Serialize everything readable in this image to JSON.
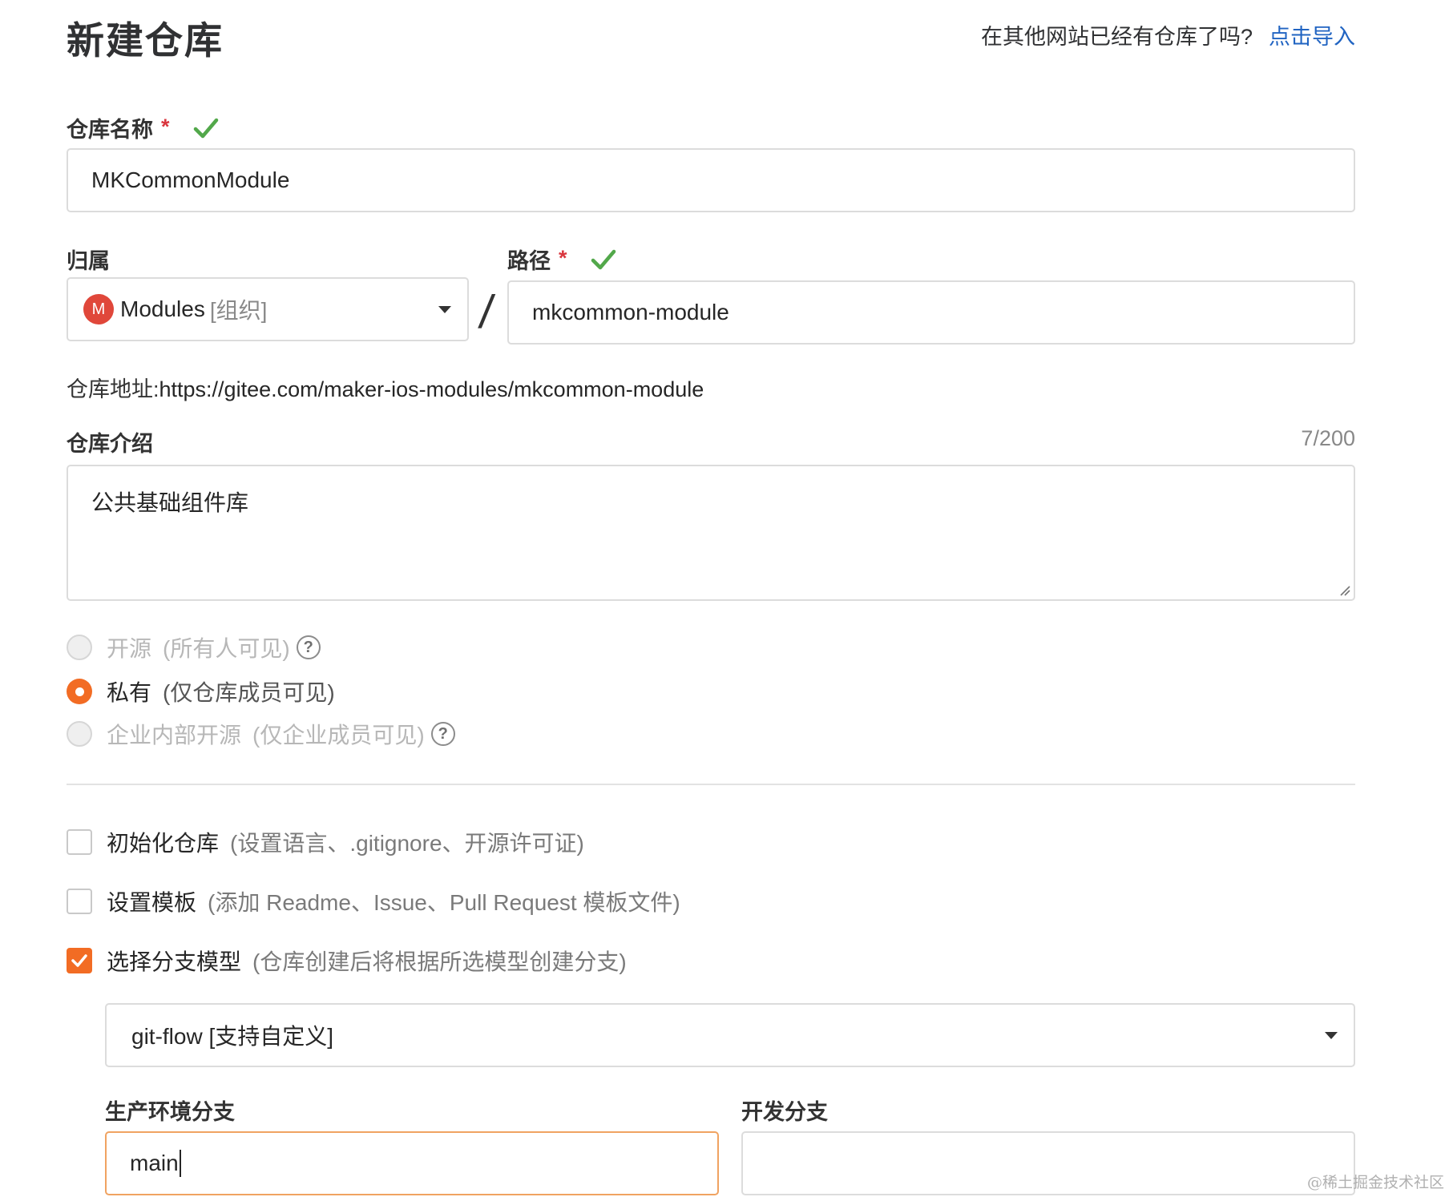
{
  "header": {
    "title": "新建仓库",
    "import_prompt": "在其他网站已经有仓库了吗?",
    "import_link": "点击导入"
  },
  "repo_name": {
    "label": "仓库名称",
    "required_mark": "*",
    "value": "MKCommonModule"
  },
  "owner": {
    "label": "归属",
    "avatar_letter": "M",
    "org_name": "Modules",
    "org_tag": "[组织]"
  },
  "path": {
    "label": "路径",
    "required_mark": "*",
    "separator": "/",
    "value": "mkcommon-module"
  },
  "address": {
    "label": "仓库地址:",
    "url": "https://gitee.com/maker-ios-modules/mkcommon-module"
  },
  "description": {
    "label": "仓库介绍",
    "counter": "7/200",
    "value": "公共基础组件库"
  },
  "visibility": {
    "options": [
      {
        "label": "开源",
        "sub": "(所有人可见)",
        "selected": false,
        "disabled": true,
        "help": "?"
      },
      {
        "label": "私有",
        "sub": "(仅仓库成员可见)",
        "selected": true,
        "disabled": false
      },
      {
        "label": "企业内部开源",
        "sub": "(仅企业成员可见)",
        "selected": false,
        "disabled": true,
        "help": "?"
      }
    ]
  },
  "options": {
    "init_repo": {
      "label": "初始化仓库",
      "sub": "(设置语言、.gitignore、开源许可证)",
      "checked": false
    },
    "templates": {
      "label": "设置模板",
      "sub": "(添加 Readme、Issue、Pull Request 模板文件)",
      "checked": false
    },
    "branch_model": {
      "label": "选择分支模型",
      "sub": "(仓库创建后将根据所选模型创建分支)",
      "checked": true
    }
  },
  "branch_model_select": {
    "value": "git-flow [支持自定义]"
  },
  "branches": {
    "production_label": "生产环境分支",
    "production_value": "main",
    "development_label": "开发分支",
    "development_value": ""
  },
  "watermark": "@稀土掘金技术社区",
  "colors": {
    "accent": "#f26c24",
    "link": "#2164c2",
    "success": "#52a84a",
    "required": "#d9363e",
    "avatar": "#e0473a"
  }
}
